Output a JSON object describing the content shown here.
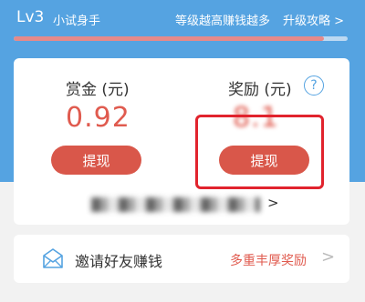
{
  "header": {
    "level_label": "Lv3",
    "level_title": "小试身手",
    "level_hint": "等级越高赚钱越多",
    "upgrade_link": "升级攻略 >",
    "progress": 0.93
  },
  "card": {
    "left": {
      "title": "赏金 (元)",
      "amount": "0.92",
      "button": "提现"
    },
    "right": {
      "title": "奖励 (元)",
      "help_icon": "?",
      "amount": "8.1",
      "button": "提现"
    },
    "history_arrow": ">"
  },
  "invite": {
    "label": "邀请好友赚钱",
    "reward": "多重丰厚奖励",
    "chevron": ">"
  },
  "colors": {
    "header_blue": "#55a3e1",
    "accent_red": "#d9574a",
    "amount_red": "#e05b4f",
    "highlight_red": "#e1232d"
  }
}
